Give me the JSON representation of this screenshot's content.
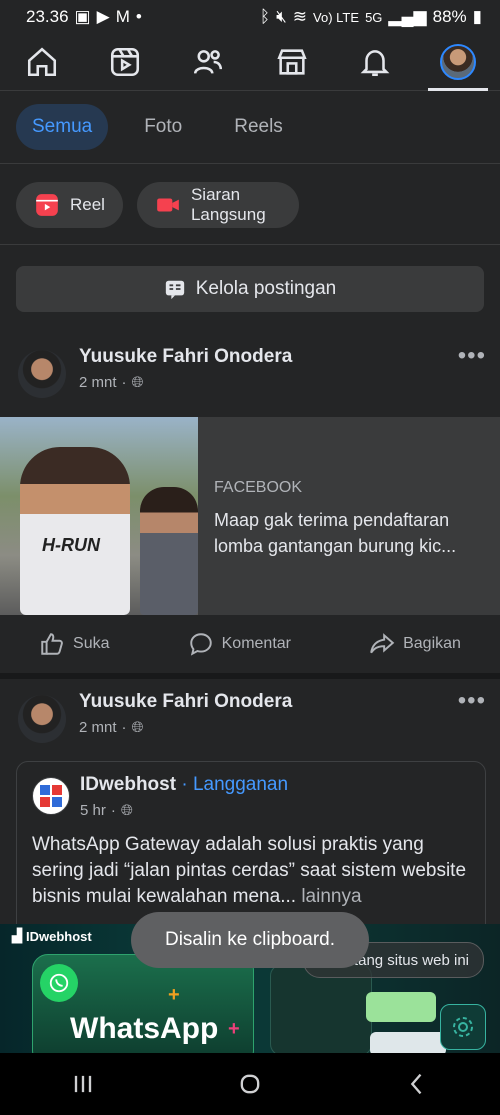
{
  "status": {
    "time": "23.36",
    "network": "Vo) LTE",
    "gen": "5G",
    "battery": "88%"
  },
  "nav": [
    "home",
    "reels",
    "friends",
    "marketplace",
    "notifications",
    "profile"
  ],
  "filters": [
    "Semua",
    "Foto",
    "Reels"
  ],
  "create": {
    "reel": "Reel",
    "live": "Siaran Langsung"
  },
  "manage_label": "Kelola postingan",
  "post1": {
    "author": "Yuusuke Fahri Onodera",
    "time": "2 mnt",
    "link_source": "FACEBOOK",
    "link_title": "Maap gak terima pendaftaran lomba gantangan burung kic...",
    "thumb_text": "H-RUN",
    "actions": {
      "like": "Suka",
      "comment": "Komentar",
      "share": "Bagikan"
    }
  },
  "post2": {
    "author": "Yuusuke Fahri Onodera",
    "time": "2 mnt",
    "shared_page": "IDwebhost",
    "shared_subscribe": "· Langganan",
    "shared_time": "5 hr",
    "shared_text": "WhatsApp Gateway adalah solusi praktis yang sering jadi “jalan pintas cerdas” saat sistem website bisnis mulai kewalahan mena...",
    "shared_more": "lainnya"
  },
  "ad": {
    "brand": "IDwebhost",
    "title": "WhatsApp",
    "about": "Tentang situs web ini"
  },
  "toast": "Disalin ke clipboard.",
  "colors": {
    "bg": "#242526",
    "accent": "#4599ff",
    "chip_active_bg": "#263951",
    "text": "#e4e6eb",
    "muted": "#b0b3b8"
  }
}
